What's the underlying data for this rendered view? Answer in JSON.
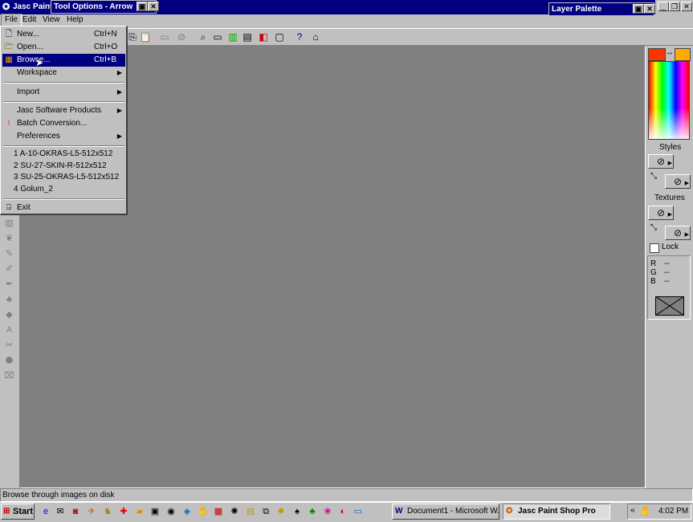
{
  "app": {
    "title": "Jasc Paint",
    "colors": {
      "titlebar": "#000080",
      "desktop": "#808080",
      "chrome": "#c0c0c0",
      "fg_swatch": "#ff3300",
      "bg_swatch": "#ffaa00"
    }
  },
  "tool_options": {
    "title": "Tool Options - Arrow"
  },
  "layer_palette": {
    "title": "Layer Palette"
  },
  "menubar": {
    "items": [
      "File",
      "Edit",
      "View",
      "Help"
    ]
  },
  "file_menu": {
    "items": [
      {
        "label": "New...",
        "shortcut": "Ctrl+N",
        "icon": "new-document-icon"
      },
      {
        "label": "Open...",
        "shortcut": "Ctrl+O",
        "icon": "open-folder-icon"
      },
      {
        "label": "Browse...",
        "shortcut": "Ctrl+B",
        "icon": "browse-icon"
      },
      {
        "label": "Workspace"
      },
      {
        "label": "Import"
      },
      {
        "label": "Jasc Software Products"
      },
      {
        "label": "Batch Conversion...",
        "icon": "batch-icon"
      },
      {
        "label": "Preferences"
      }
    ],
    "recent": [
      "1 A-10-OKRAS-L5-512x512",
      "2 SU-27-SKIN-R-512x512",
      "3 SU-25-OKRAS-L5-512x512",
      "4 Golum_2"
    ],
    "exit": {
      "label": "Exit",
      "icon": "exit-icon"
    }
  },
  "color_palette": {
    "styles_label": "Styles",
    "textures_label": "Textures",
    "lock_label": "Lock",
    "rgb": {
      "r_label": "R",
      "g_label": "G",
      "b_label": "B",
      "r_value": "--",
      "g_value": "--",
      "b_value": "--"
    }
  },
  "status_bar": {
    "text": "Browse through images on disk"
  },
  "taskbar": {
    "start_label": "Start",
    "tasks": [
      "Document1 - Microsoft W...",
      "Jasc Paint Shop Pro"
    ],
    "tray_arrow": "«",
    "clock": "4:02 PM"
  }
}
